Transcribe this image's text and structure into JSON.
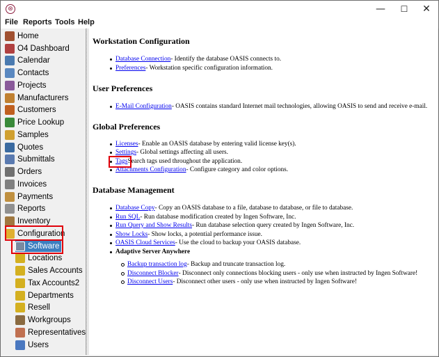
{
  "window": {
    "minimize": "—",
    "maximize": "☐",
    "close": "✕",
    "app_icon": "⊛"
  },
  "menu": [
    "File",
    "Reports",
    "Tools",
    "Help"
  ],
  "sidebar": [
    {
      "label": "Home",
      "icon": "home-icon",
      "color": "#a05030"
    },
    {
      "label": "O4 Dashboard",
      "icon": "dashboard-icon",
      "color": "#b04040"
    },
    {
      "label": "Calendar",
      "icon": "calendar-icon",
      "color": "#4a7ab0"
    },
    {
      "label": "Contacts",
      "icon": "contacts-icon",
      "color": "#5a88c0"
    },
    {
      "label": "Projects",
      "icon": "projects-icon",
      "color": "#8a5a9a"
    },
    {
      "label": "Manufacturers",
      "icon": "manufacturers-icon",
      "color": "#c08030"
    },
    {
      "label": "Customers",
      "icon": "customers-icon",
      "color": "#c06020"
    },
    {
      "label": "Price Lookup",
      "icon": "price-icon",
      "color": "#3a8a3a"
    },
    {
      "label": "Samples",
      "icon": "samples-icon",
      "color": "#d0a030"
    },
    {
      "label": "Quotes",
      "icon": "quotes-icon",
      "color": "#3a6aa0"
    },
    {
      "label": "Submittals",
      "icon": "submittals-icon",
      "color": "#5a7ab0"
    },
    {
      "label": "Orders",
      "icon": "orders-icon",
      "color": "#707070"
    },
    {
      "label": "Invoices",
      "icon": "invoices-icon",
      "color": "#808080"
    },
    {
      "label": "Payments",
      "icon": "payments-icon",
      "color": "#c09040"
    },
    {
      "label": "Reports",
      "icon": "reports-icon",
      "color": "#909090"
    },
    {
      "label": "Inventory",
      "icon": "inventory-icon",
      "color": "#a07840"
    },
    {
      "label": "Configuration",
      "icon": "configuration-icon",
      "color": "#e0b030"
    },
    {
      "label": "Software",
      "icon": "software-icon",
      "color": "#7a8aa0"
    },
    {
      "label": "Locations",
      "icon": "locations-icon",
      "color": "#d4b020"
    },
    {
      "label": "Sales Accounts",
      "icon": "sales-accounts-icon",
      "color": "#d4b020"
    },
    {
      "label": "Tax Accounts2",
      "icon": "tax-accounts-icon",
      "color": "#d4b020"
    },
    {
      "label": "Departments",
      "icon": "departments-icon",
      "color": "#d4b020"
    },
    {
      "label": "Resell",
      "icon": "resell-icon",
      "color": "#d4b020"
    },
    {
      "label": "Workgroups",
      "icon": "workgroups-icon",
      "color": "#8a6a40"
    },
    {
      "label": "Representatives",
      "icon": "representatives-icon",
      "color": "#c07050"
    },
    {
      "label": "Users",
      "icon": "users-icon",
      "color": "#4a78c0"
    }
  ],
  "content": {
    "workstation": {
      "heading": "Workstation Configuration",
      "items": [
        {
          "link": "Database Connection",
          "desc": " - Identify the database OASIS connects to."
        },
        {
          "link": "Preferences",
          "desc": " - Workstation specific configuration information."
        }
      ]
    },
    "user_prefs": {
      "heading": "User Preferences",
      "items": [
        {
          "link": "E-Mail Configuration",
          "desc": " - OASIS contains standard Internet mail technologies, allowing OASIS to send and receive e-mail."
        }
      ]
    },
    "global_prefs": {
      "heading": "Global Preferences",
      "items": [
        {
          "link": "Licenses",
          "desc": " - Enable an OASIS database by entering valid license key(s)."
        },
        {
          "link": "Settings",
          "desc": " - Global settings affecting all users."
        },
        {
          "link": "Tags",
          "desc": " Search tags used throughout the application."
        },
        {
          "link": "Attachments Configuration",
          "desc": " - Configure category and color options."
        }
      ]
    },
    "db_mgmt": {
      "heading": "Database Management",
      "items": [
        {
          "link": "Database Copy",
          "desc": " - Copy an OASIS database to a file, database to database, or file to database."
        },
        {
          "link": "Run SQL",
          "desc": " - Run database modification created by Ingen Software, Inc."
        },
        {
          "link": "Run Query and Show Results",
          "desc": " - Run database selection query created by Ingen Software, Inc."
        },
        {
          "link": "Show Locks",
          "desc": " - Show locks, a potential performance issue."
        },
        {
          "link": "OASIS Cloud Services",
          "desc": " - Use the cloud to backup your OASIS database."
        }
      ],
      "asa_label": "Adaptive Server Anywhere",
      "asa_items": [
        {
          "link": "Backup transaction log",
          "desc": " - Backup and truncate transaction log."
        },
        {
          "link": "Disconnect Blocker",
          "desc": " - Disconnect only connections blocking users - only use when instructed by Ingen Software!"
        },
        {
          "link": "Disconnect Users",
          "desc": " - Disconnect other users - only use when instructed by Ingen Software!"
        }
      ]
    }
  },
  "colors": {
    "highlight": "#e0000a",
    "link": "#0000ee",
    "selected": "#3c7fc0"
  }
}
